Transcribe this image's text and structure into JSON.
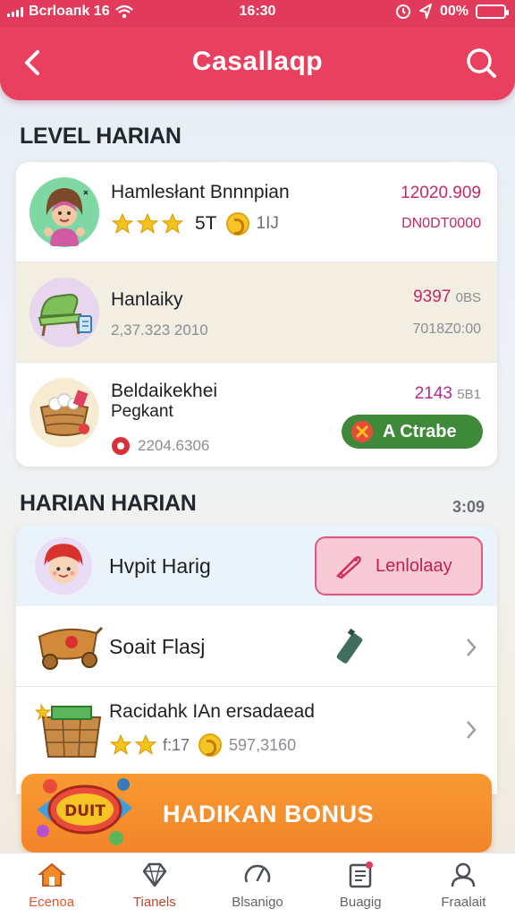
{
  "status_bar": {
    "carrier": "Bcrloaпk 16",
    "time": "16:30",
    "battery": "00%"
  },
  "header": {
    "title": "Casallaqp"
  },
  "section1": {
    "title": "LEVEL HARIAN",
    "rows": [
      {
        "title": "Hamlesłant Bnnnpian",
        "stars": 3,
        "badge_text": "5T",
        "coin_suffix": "1IJ",
        "value": "12020.909",
        "value2": "DN0DT0000"
      },
      {
        "title": "Hanlaiky",
        "subtitle": "2,37.323 2010",
        "value": "9397",
        "value_small": "0BS",
        "value2": "7018Z0:00"
      },
      {
        "title": "Beldaikekhei",
        "title2": "Pegkant",
        "subtitle": "2204.6306",
        "value": "2143",
        "value_small": "5B1",
        "button": "A Ctrabe"
      }
    ]
  },
  "section2": {
    "title": "HARIAN HARIAN",
    "meta": "3:09",
    "rows": [
      {
        "title": "Hvpit Harig",
        "button": "Lenlolaay"
      },
      {
        "title": "Soait Flasj"
      },
      {
        "title": "Racidahk IAn ersadaead",
        "stars": 2,
        "coin_prefix": "f:17",
        "coin_value": "597,3160"
      }
    ]
  },
  "bonus": {
    "label": "HADIKAN BONUS",
    "candy_text": "DUIT"
  },
  "bottom_nav": [
    {
      "label": "Ecenoa",
      "icon": "home-icon",
      "active": true
    },
    {
      "label": "Tianels",
      "icon": "gem-icon",
      "active": false
    },
    {
      "label": "Blsanigo",
      "icon": "gauge-icon",
      "active": false
    },
    {
      "label": "Buagig",
      "icon": "notes-icon",
      "active": false
    },
    {
      "label": "Fraalait",
      "icon": "profile-icon",
      "active": false
    }
  ],
  "colors": {
    "accent": "#e9405f",
    "price": "#c2286a",
    "green_button": "#3f8a3a",
    "bonus": "#f2852a",
    "nav_active": "#e0562a"
  }
}
